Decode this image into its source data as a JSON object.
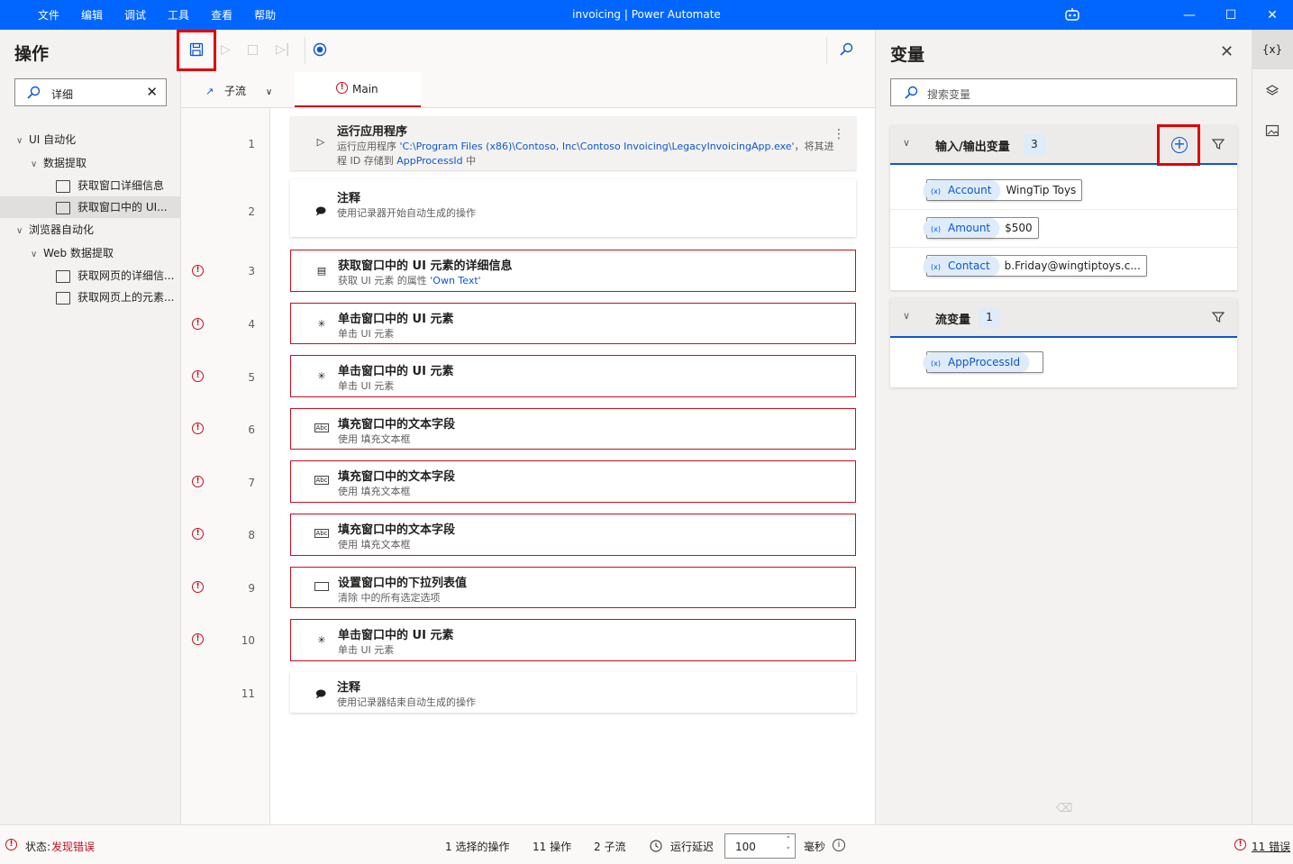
{
  "window": {
    "title": "invoicing | Power Automate",
    "menu": [
      "文件",
      "编辑",
      "调试",
      "工具",
      "查看",
      "帮助"
    ]
  },
  "actions_panel": {
    "title": "操作",
    "search_value": "详细",
    "tree": [
      {
        "label": "UI 自动化",
        "level": 0,
        "expanded": true
      },
      {
        "label": "数据提取",
        "level": 1,
        "expanded": true
      },
      {
        "label": "获取窗口详细信息",
        "level": 2
      },
      {
        "label": "获取窗口中的 UI...",
        "level": 2,
        "selected": true
      },
      {
        "label": "浏览器自动化",
        "level": 0,
        "expanded": true
      },
      {
        "label": "Web 数据提取",
        "level": 1,
        "expanded": true
      },
      {
        "label": "获取网页的详细信...",
        "level": 2
      },
      {
        "label": "获取网页上的元素...",
        "level": 2
      }
    ]
  },
  "tabs": {
    "subflows_label": "子流",
    "main_label": "Main"
  },
  "steps": [
    {
      "no": "1",
      "title": "运行应用程序",
      "desc_a": "运行应用程序 ",
      "desc_link": "'C:\\Program Files (x86)\\Contoso, Inc\\Contoso Invoicing\\LegacyInvoicingApp.exe'",
      "desc_b": "，将其进",
      "desc2_a": "程 ID 存储到 ",
      "desc2_link": "AppProcessId",
      "desc2_b": " 中",
      "error": false
    },
    {
      "no": "2",
      "title": "注释",
      "desc_link": "使用记录器开始自动生成的操作",
      "error": false
    },
    {
      "no": "3",
      "title": "获取窗口中的 UI 元素的详细信息",
      "desc_a": "获取 UI 元素  的属性 ",
      "desc_link": "'Own Text'",
      "error": true
    },
    {
      "no": "4",
      "title": "单击窗口中的 UI 元素",
      "desc_a": "单击 UI 元素",
      "error": true
    },
    {
      "no": "5",
      "title": "单击窗口中的 UI 元素",
      "desc_a": "单击 UI 元素",
      "error": true
    },
    {
      "no": "6",
      "title": "填充窗口中的文本字段",
      "desc_a": "使用  填充文本框",
      "error": true
    },
    {
      "no": "7",
      "title": "填充窗口中的文本字段",
      "desc_a": "使用  填充文本框",
      "error": true
    },
    {
      "no": "8",
      "title": "填充窗口中的文本字段",
      "desc_a": "使用  填充文本框",
      "error": true
    },
    {
      "no": "9",
      "title": "设置窗口中的下拉列表值",
      "desc_a": "清除  中的所有选定选项",
      "error": true
    },
    {
      "no": "10",
      "title": "单击窗口中的 UI 元素",
      "desc_a": "单击 UI 元素",
      "error": true
    },
    {
      "no": "11",
      "title": "注释",
      "desc_link": "使用记录器结束自动生成的操作",
      "error": false
    }
  ],
  "variables_panel": {
    "title": "变量",
    "search_placeholder": "搜索变量",
    "io_section": {
      "label": "输入/输出变量",
      "count": "3"
    },
    "io_vars": [
      {
        "name": "Account",
        "value": "WingTip Toys"
      },
      {
        "name": "Amount",
        "value": "$500"
      },
      {
        "name": "Contact",
        "value": "b.Friday@wingtiptoys.c..."
      }
    ],
    "flow_section": {
      "label": "流变量",
      "count": "1"
    },
    "flow_vars": [
      {
        "name": "AppProcessId",
        "value": ""
      }
    ]
  },
  "rail": {
    "vars_label": "{x}"
  },
  "statusbar": {
    "status_label": "状态: ",
    "status_value": "发现错误",
    "selected": "1 选择的操作",
    "actions": "11 操作",
    "subflows": "2 子流",
    "delay_label": "运行延迟",
    "delay_value": "100",
    "delay_unit": "毫秒",
    "errors": "11 错误"
  },
  "colors": {
    "accent": "#0066ff",
    "error": "#c50f1f",
    "link": "#0b57d0",
    "highlight": "#e00000"
  }
}
